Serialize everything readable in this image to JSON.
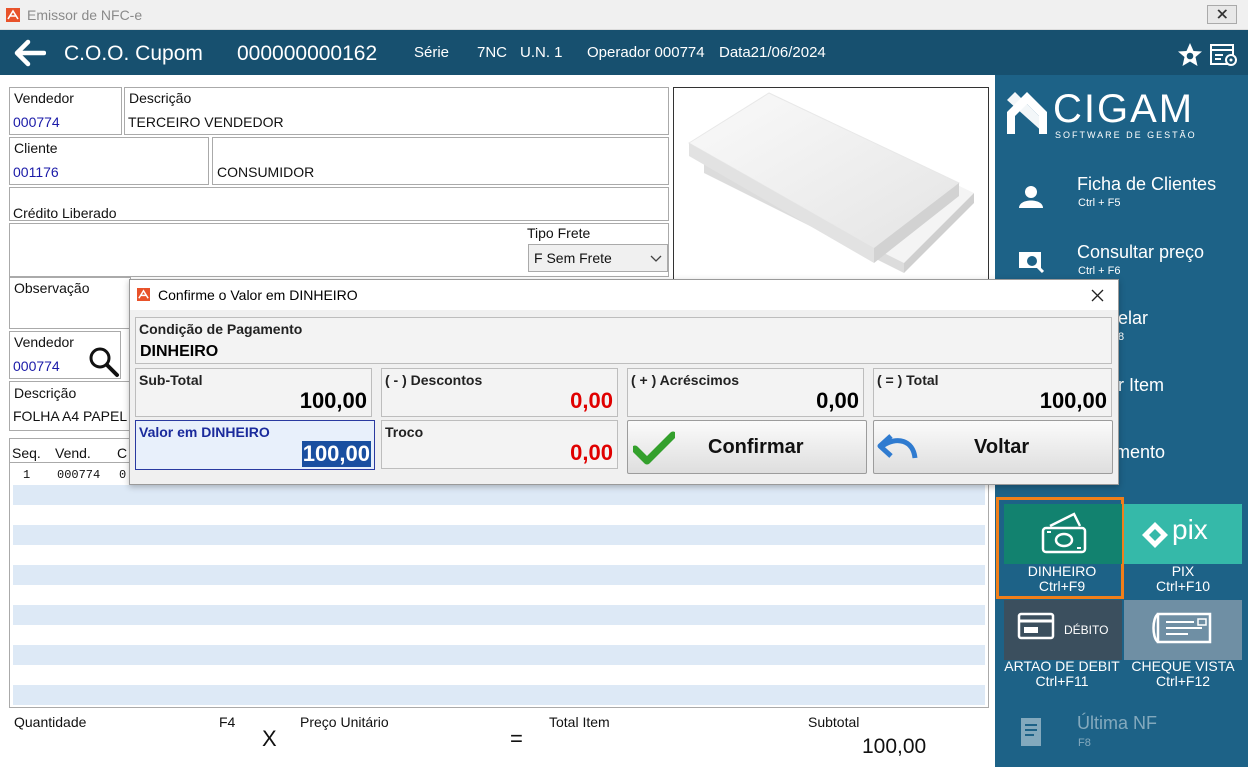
{
  "window": {
    "title": "Emissor de NFC-e"
  },
  "header": {
    "coo_label": "C.O.O. Cupom",
    "coo_number": "000000000162",
    "serie_label": "Série",
    "serie_value": "7NC",
    "un": "U.N. 1",
    "operador": "Operador 000774",
    "data": "Data21/06/2024"
  },
  "form": {
    "vendedor_label": "Vendedor",
    "vendedor_value": "000774",
    "descricao_label": "Descrição",
    "descricao_value": "TERCEIRO VENDEDOR",
    "cliente_label": "Cliente",
    "cliente_value": "001176",
    "cliente_nome": "CONSUMIDOR",
    "credito_label": "Crédito Liberado",
    "tipo_frete_label": "Tipo Frete",
    "tipo_frete_value": "F Sem Frete",
    "observacao_label": "Observação",
    "vendedor2_label": "Vendedor",
    "vendedor2_value": "000774",
    "descricao2_label": "Descrição",
    "descricao2_value": "FOLHA A4 PAPEL"
  },
  "table": {
    "headers": [
      "Seq.",
      "Vend.",
      "C"
    ],
    "row1": [
      "1",
      "000774",
      "0"
    ]
  },
  "footer": {
    "quantidade_label": "Quantidade",
    "f4": "F4",
    "x": "X",
    "preco_label": "Preço Unitário",
    "eq": "=",
    "total_item_label": "Total Item",
    "subtotal_label": "Subtotal",
    "subtotal_value": "100,00"
  },
  "sidebar": {
    "logo": "CIGAM",
    "logo_sub": "SOFTWARE DE GESTÃO",
    "items": [
      {
        "label": "Ficha de Clientes",
        "shortcut": "Ctrl + F5"
      },
      {
        "label": "Consultar preço",
        "shortcut": "Ctrl + F6"
      },
      {
        "label": "elar",
        "shortcut": "8"
      },
      {
        "label": "r Item",
        "shortcut": ""
      },
      {
        "label": "mento",
        "shortcut": ""
      }
    ],
    "payments": [
      {
        "label": "DINHEIRO",
        "shortcut": "Ctrl+F9"
      },
      {
        "label": "PIX",
        "shortcut": "Ctrl+F10",
        "logo": "pix"
      },
      {
        "label": "ARTAO DE DEBIT",
        "shortcut": "Ctrl+F11",
        "tile_text": "DÉBITO"
      },
      {
        "label": "CHEQUE VISTA",
        "shortcut": "Ctrl+F12"
      }
    ],
    "ultima_nf": {
      "label": "Última NF",
      "shortcut": "F8"
    }
  },
  "dialog": {
    "title": "Confirme o Valor em DINHEIRO",
    "condicao_label": "Condição de Pagamento",
    "condicao_value": "DINHEIRO",
    "subtotal_label": "Sub-Total",
    "subtotal_value": "100,00",
    "descontos_label": "( - ) Descontos",
    "descontos_value": "0,00",
    "acrescimos_label": "( + ) Acréscimos",
    "acrescimos_value": "0,00",
    "total_label": "( = ) Total",
    "total_value": "100,00",
    "valor_label": "Valor em DINHEIRO",
    "valor_value": "100,00",
    "troco_label": "Troco",
    "troco_value": "0,00",
    "confirmar_label": "Confirmar",
    "voltar_label": "Voltar"
  },
  "colors": {
    "header_bg": "#17506f",
    "sidebar_bg": "#1d6287",
    "dinheiro_tile": "#12826f",
    "pix_tile": "#35b9a9",
    "debito_tile": "#3b4f5e",
    "cheque_tile": "#6f8fa4",
    "highlight_border": "#f07f1a",
    "red_value": "#e00000"
  }
}
